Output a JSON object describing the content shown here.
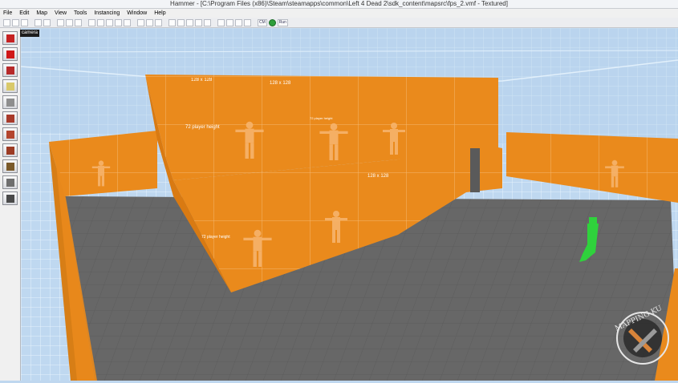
{
  "window": {
    "title": "Hammer - [C:\\Program Files (x86)\\Steam\\steamapps\\common\\Left 4 Dead 2\\sdk_content\\mapsrc\\fps_2.vmf - Textured]"
  },
  "menu": [
    "File",
    "Edit",
    "Map",
    "View",
    "Tools",
    "Instancing",
    "Window",
    "Help"
  ],
  "toolbar": {
    "groups": [
      [
        "new-icon",
        "open-icon",
        "save-icon"
      ],
      [
        "undo-icon",
        "redo-icon"
      ],
      [
        "cut-icon",
        "copy-icon",
        "paste-icon"
      ],
      [
        "carve-icon",
        "group-icon",
        "ungroup-icon",
        "hide-icon",
        "texture-lock-icon"
      ],
      [
        "grid-icon",
        "grid-smaller-icon",
        "grid-larger-icon"
      ],
      [
        "camera-2d-icon",
        "3d-wireframe-icon",
        "3d-polygon-icon",
        "3d-textured-icon",
        "3d-lighting-icon"
      ],
      [
        "entity-report-icon",
        "check-map-icon",
        "compile-icon",
        "game-icon"
      ]
    ],
    "cm_label": "CM",
    "run_label": "Run"
  },
  "left_tools": [
    {
      "name": "selection-tool",
      "icon": "pointer-icon",
      "color": "#c62222"
    },
    {
      "name": "magnify-tool",
      "icon": "magnify-icon",
      "color": "#d01818"
    },
    {
      "name": "camera-tool",
      "icon": "camera-icon",
      "color": "#b72a2a"
    },
    {
      "name": "entity-tool",
      "icon": "entity-light-icon",
      "color": "#d9c96a"
    },
    {
      "name": "block-tool",
      "icon": "block-icon",
      "color": "#8e8e8e"
    },
    {
      "name": "texture-tool",
      "icon": "texture-icon",
      "color": "#a83a2a"
    },
    {
      "name": "apply-texture-tool",
      "icon": "apply-texture-icon",
      "color": "#b4452e"
    },
    {
      "name": "decal-tool",
      "icon": "decal-icon",
      "color": "#9c3b24"
    },
    {
      "name": "overlay-tool",
      "icon": "overlay-icon",
      "color": "#7a5a2a"
    },
    {
      "name": "clip-tool",
      "icon": "clip-icon",
      "color": "#6e6e6e"
    },
    {
      "name": "vertex-tool",
      "icon": "vertex-icon",
      "color": "#4a4a4a"
    }
  ],
  "tooltip": "camera",
  "viewport": {
    "wall_labels": {
      "grid_label": "128 x 128",
      "player_height": "72 player height"
    },
    "colors": {
      "sky": "#bcd6ef",
      "wall": "#ea8a1c",
      "wall_shade": "#d97a12",
      "floor": "#676767",
      "player": "#2fd23c"
    }
  },
  "watermark": {
    "text": "MAPPING KU"
  }
}
